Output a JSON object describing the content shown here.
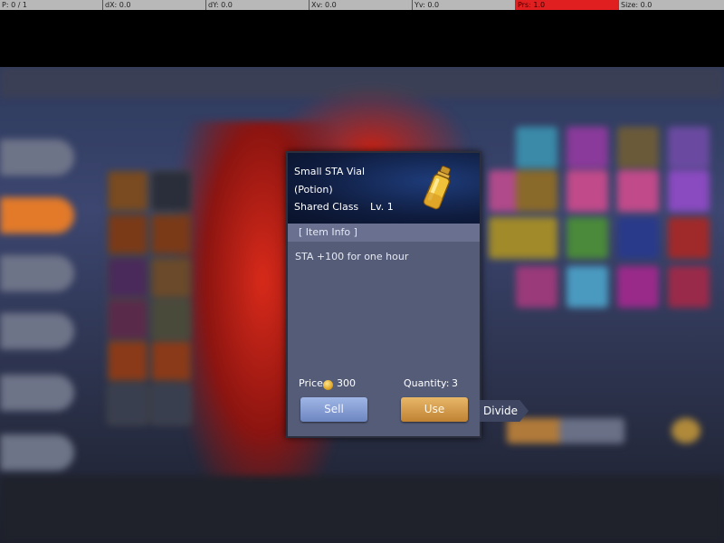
{
  "debug_bar": {
    "pointer": "P: 0 / 1",
    "dx": "dX: 0.0",
    "dy": "dY: 0.0",
    "xv": "Xv: 0.0",
    "yv": "Yv: 0.0",
    "prs": "Prs: 1.0",
    "size": "Size: 0.0"
  },
  "popup": {
    "item_name": "Small STA Vial",
    "item_type": "(Potion)",
    "item_class": "Shared Class",
    "item_level": "Lv. 1",
    "section_title": "[ Item Info ]",
    "description": "STA +100 for one hour",
    "price_label": "Price",
    "price_value": "300",
    "quantity_label": "Quantity:",
    "quantity_value": "3",
    "sell_label": "Sell",
    "use_label": "Use",
    "divide_label": "Divide"
  },
  "colors": {
    "accent_use": "#c08233",
    "accent_sell": "#6d86c0",
    "debug_highlight": "#e02020"
  },
  "icons": {
    "item": "potion-vial-icon",
    "price": "gold-coin-icon"
  }
}
